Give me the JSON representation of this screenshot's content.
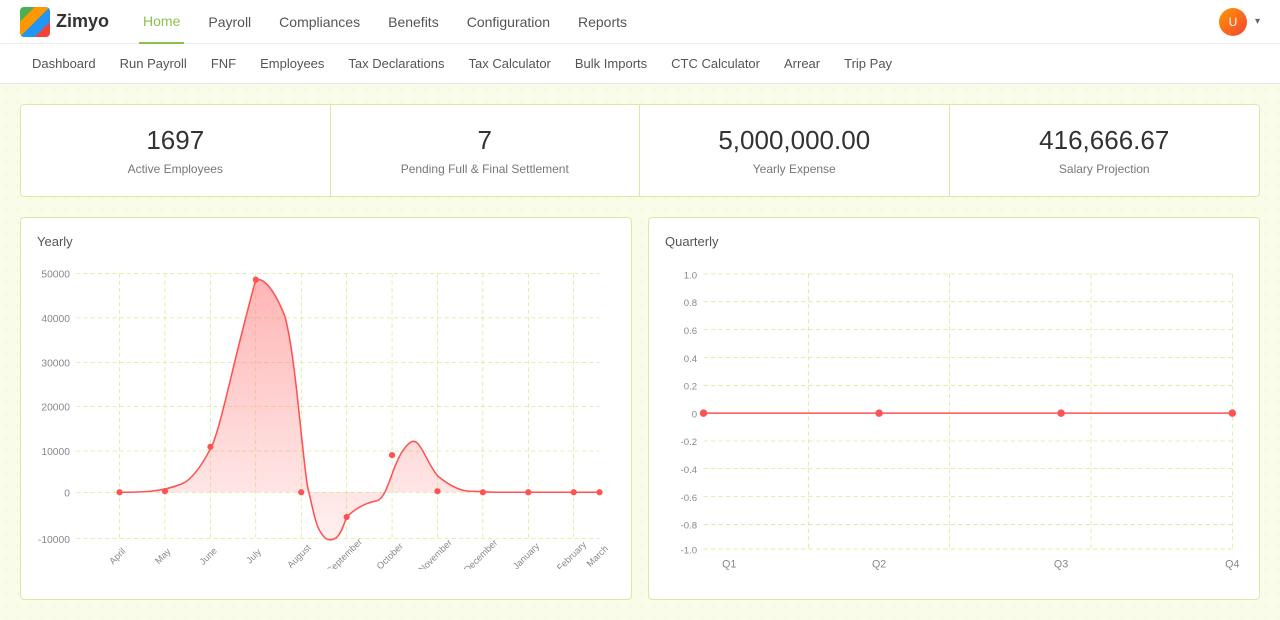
{
  "logo": {
    "text": "Zimyo"
  },
  "topNav": {
    "items": [
      {
        "label": "Home",
        "active": true
      },
      {
        "label": "Payroll",
        "active": false
      },
      {
        "label": "Compliances",
        "active": false
      },
      {
        "label": "Benefits",
        "active": false
      },
      {
        "label": "Configuration",
        "active": false
      },
      {
        "label": "Reports",
        "active": false
      }
    ]
  },
  "subNav": {
    "items": [
      {
        "label": "Dashboard"
      },
      {
        "label": "Run Payroll"
      },
      {
        "label": "FNF"
      },
      {
        "label": "Employees"
      },
      {
        "label": "Tax Declarations"
      },
      {
        "label": "Tax Calculator"
      },
      {
        "label": "Bulk Imports"
      },
      {
        "label": "CTC Calculator"
      },
      {
        "label": "Arrear"
      },
      {
        "label": "Trip Pay"
      }
    ]
  },
  "stats": [
    {
      "number": "1697",
      "label": "Active Employees"
    },
    {
      "number": "7",
      "label": "Pending Full & Final Settlement"
    },
    {
      "number": "5,000,000.00",
      "label": "Yearly Expense"
    },
    {
      "number": "416,666.67",
      "label": "Salary Projection"
    }
  ],
  "yearlyChart": {
    "title": "Yearly",
    "yLabels": [
      "50000",
      "40000",
      "30000",
      "20000",
      "10000",
      "0",
      "-10000"
    ],
    "xLabels": [
      "April",
      "May",
      "June",
      "July",
      "August",
      "September",
      "October",
      "November",
      "December",
      "January",
      "February",
      "March"
    ]
  },
  "quarterlyChart": {
    "title": "Quarterly",
    "yLabels": [
      "1.0",
      "0.8",
      "0.6",
      "0.4",
      "0.2",
      "0",
      "-0.2",
      "-0.4",
      "-0.6",
      "-0.8",
      "-1.0"
    ],
    "xLabels": [
      "Q1",
      "Q2",
      "Q3",
      "Q4"
    ]
  }
}
